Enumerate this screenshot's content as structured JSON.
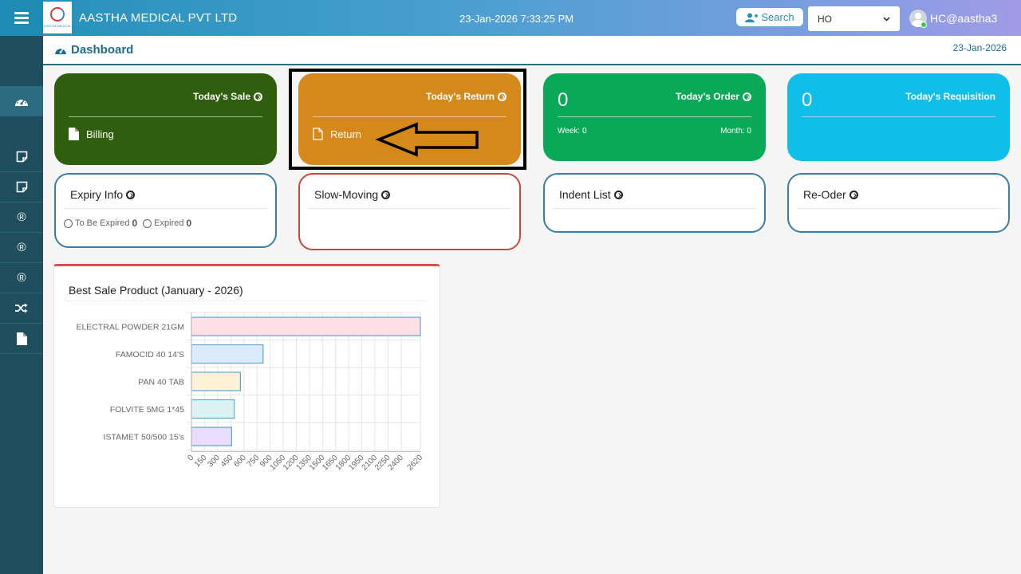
{
  "header": {
    "logo_text": "AASTHA MEDICAL",
    "brand": "AASTHA MEDICAL PVT LTD",
    "datetime": "23-Jan-2026 7:33:25 PM",
    "search_label": "Search",
    "branch_value": "HO",
    "user": "HC@aastha3"
  },
  "page": {
    "title": "Dashboard",
    "date": "23-Jan-2026"
  },
  "cards": {
    "sale": {
      "title": "Today's Sale",
      "link": "Billing",
      "color": "#2e5e0e"
    },
    "return": {
      "title": "Today's Return",
      "link": "Return",
      "color": "#d4891a"
    },
    "order": {
      "title": "Today's Order",
      "value": "0",
      "week": "Week: 0",
      "month": "Month: 0",
      "color": "#0aa957"
    },
    "requisition": {
      "title": "Today's Requisition",
      "value": "0",
      "color": "#0fbfea"
    }
  },
  "info": {
    "expiry": {
      "title": "Expiry Info",
      "to_be_expired_label": "To Be Expired",
      "to_be_expired_count": "0",
      "expired_label": "Expired",
      "expired_count": "0"
    },
    "slow_moving": {
      "title": "Slow-Moving"
    },
    "indent": {
      "title": "Indent List"
    },
    "reorder": {
      "title": "Re-Oder"
    }
  },
  "chart_data": {
    "type": "bar",
    "orientation": "horizontal",
    "title": "Best Sale Product (January - 2026)",
    "categories": [
      "ELECTRAL POWDER 21GM",
      "FAMOCID 40 14'S",
      "PAN 40 TAB",
      "FOLVITE 5MG 1*45",
      "ISTAMET 50/500 15's"
    ],
    "values": [
      2620,
      820,
      560,
      490,
      460
    ],
    "bar_colors": [
      "#ffe0e6",
      "#dcebfb",
      "#fdf2d8",
      "#dcf3f1",
      "#e8ddfc"
    ],
    "bar_borders": [
      "#5aa8cf",
      "#5aa8cf",
      "#5aa8cf",
      "#5aa8cf",
      "#5aa8cf"
    ],
    "x_ticks": [
      "0",
      "150",
      "300",
      "450",
      "600",
      "750",
      "900",
      "1050",
      "1200",
      "1350",
      "1500",
      "1650",
      "1800",
      "1950",
      "2100",
      "2250",
      "2400",
      "2620"
    ],
    "xlim": [
      0,
      2620
    ],
    "grid": true
  }
}
